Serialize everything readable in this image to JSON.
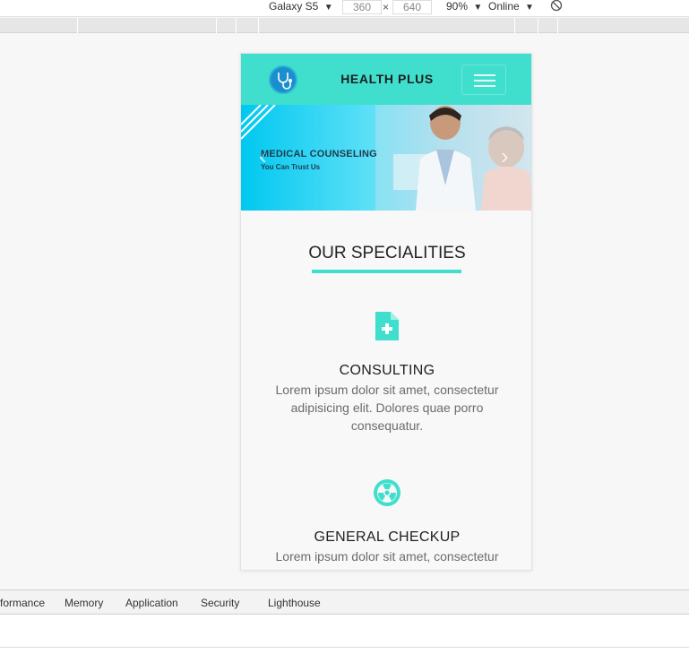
{
  "devtools_toolbar": {
    "device": "Galaxy S5",
    "width": "360",
    "times": "×",
    "height": "640",
    "zoom": "90%",
    "network": "Online",
    "dropdown_arrow": "▼"
  },
  "site": {
    "brand": "HEALTH PLUS",
    "hero": {
      "title": "MEDICAL COUNSELING",
      "subtitle": "You Can Trust Us"
    },
    "section_title": "OUR SPECIALITIES",
    "features": [
      {
        "icon": "medical-file-icon",
        "title": "CONSULTING",
        "text": "Lorem ipsum dolor sit amet, consectetur adipisicing elit. Dolores quae porro consequatur."
      },
      {
        "icon": "radiation-icon",
        "title": "GENERAL CHECKUP",
        "text": "Lorem ipsum dolor sit amet, consectetur adipisicing elit. Dolores quae porro consequatur."
      }
    ]
  },
  "devtools_tabs": [
    "formance",
    "Memory",
    "Application",
    "Security",
    "Lighthouse"
  ],
  "colors": {
    "accent": "#40dfcd",
    "navbar": "#40dfcd"
  }
}
